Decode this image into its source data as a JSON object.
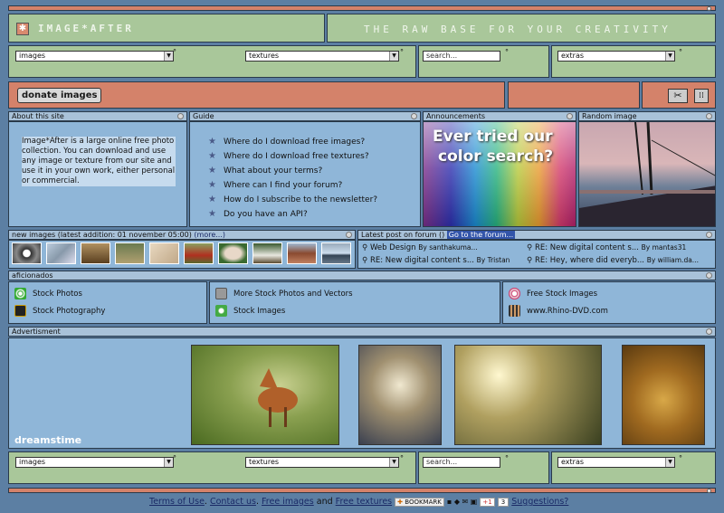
{
  "header": {
    "logo_text": "IMAGE*AFTER",
    "tagline": "THE RAW BASE FOR YOUR CREATIVITY"
  },
  "nav": {
    "images_select": "images",
    "textures_select": "textures",
    "search_placeholder": "search...",
    "extras_select": "extras",
    "degree": "°"
  },
  "toolbar": {
    "donate_label": "donate images"
  },
  "about": {
    "header": "About this site",
    "text": "Image*After is a large online free photo collection. You can download and use any image or texture from our site and use it in your own work, either personal or commercial."
  },
  "guide": {
    "header": "Guide",
    "items": [
      "Where do I download free images?",
      "Where do I download free textures?",
      "What about your terms?",
      "Where can I find your forum?",
      "How do I subscribe to the newsletter?",
      "Do you have an API?"
    ]
  },
  "announcements": {
    "header": "Announcements",
    "banner_line1": "Ever tried our",
    "banner_line2": "color search?"
  },
  "random": {
    "header": "Random image"
  },
  "new_images": {
    "header": "new images (latest addition: 01 november 05:00)",
    "more_label": "(more...)"
  },
  "forum": {
    "header": "Latest post on forum ()",
    "goto_label": "Go to the forum...",
    "posts": [
      {
        "title": "Web Design",
        "by": "By santhakuma..."
      },
      {
        "title": "RE: New digital content s...",
        "by": "By mantas31"
      },
      {
        "title": "RE: New digital content s...",
        "by": "By Tristan"
      },
      {
        "title": "RE: Hey, where did everyb...",
        "by": "By william.da..."
      }
    ]
  },
  "aficionados": {
    "header": "aficionados",
    "links": [
      "Stock Photos",
      "Stock Photography",
      "More Stock Photos and Vectors",
      "Stock Images",
      "Free Stock Images",
      "www.Rhino-DVD.com"
    ]
  },
  "advertisment": {
    "header": "Advertisment",
    "brand": "dreamstime"
  },
  "footer": {
    "terms": "Terms of Use",
    "sep1": ".",
    "contact": "Contact us",
    "sep2": ".",
    "free_images": "Free images",
    "and": "and",
    "free_textures": "Free textures",
    "bookmark": "BOOKMARK",
    "plus_one": "+1",
    "count": "3",
    "suggestions": "Suggestions?"
  },
  "colors": {
    "bg": "#5c7fa3",
    "green": "#a9c79a",
    "salmon": "#d4826a",
    "panel": "#8fb6d8"
  }
}
